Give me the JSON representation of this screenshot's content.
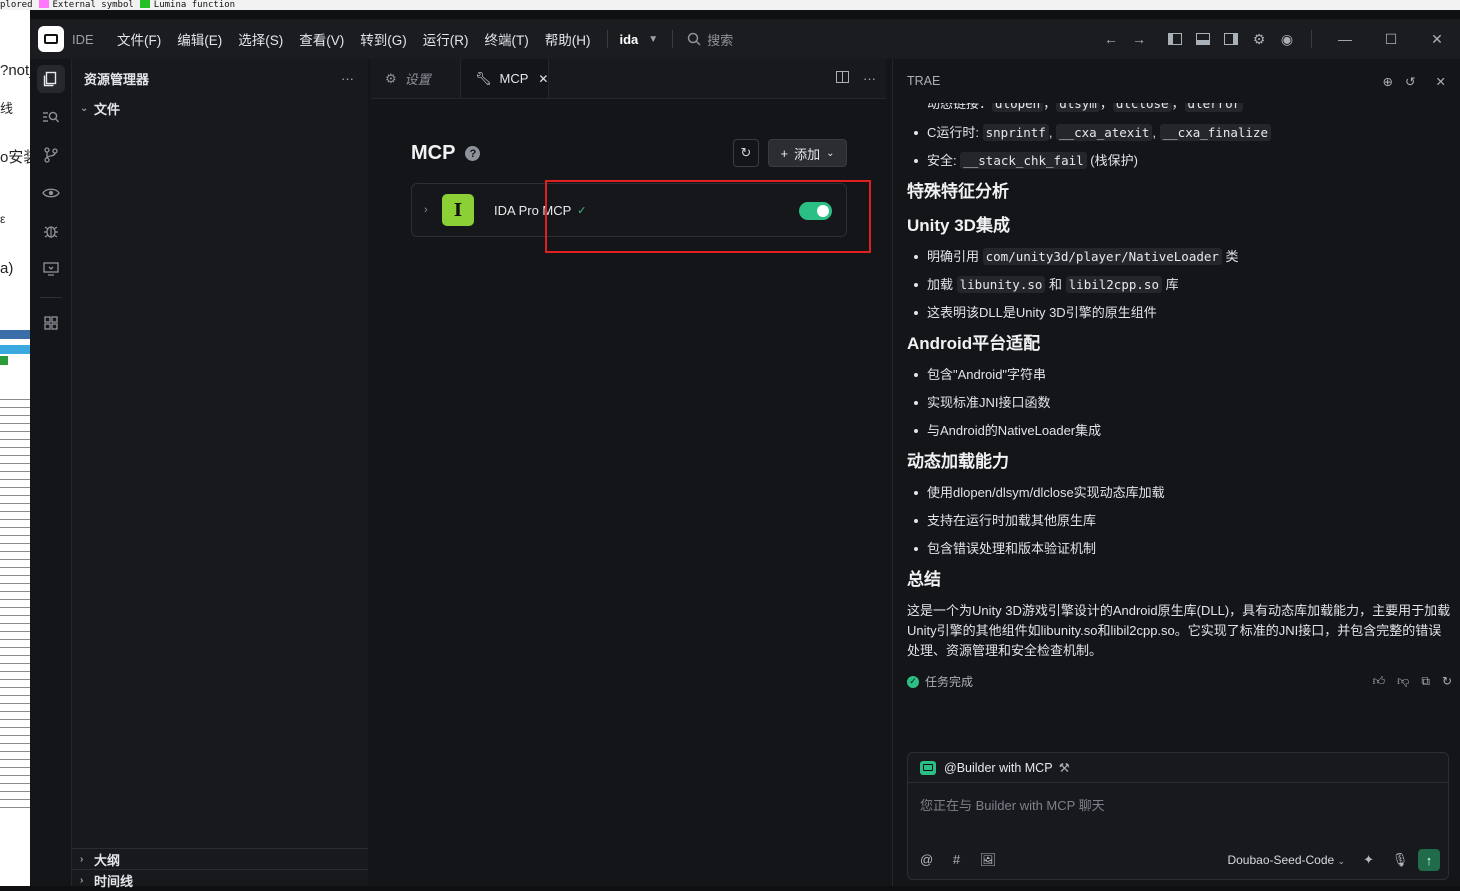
{
  "background": {
    "top_legend": [
      "plored",
      "External symbol",
      "Lumina function"
    ],
    "left_fragments": [
      "?not_",
      "线",
      "o安装",
      "ε",
      "a)"
    ]
  },
  "titlebar": {
    "ide_label": "IDE",
    "menu": [
      "文件(F)",
      "编辑(E)",
      "选择(S)",
      "查看(V)",
      "转到(G)",
      "运行(R)",
      "终端(T)",
      "帮助(H)"
    ],
    "project": "ida",
    "search_placeholder": "搜索"
  },
  "explorer": {
    "title": "资源管理器",
    "root": "文件",
    "outline": "大纲",
    "timeline": "时间线"
  },
  "editor": {
    "tabs": [
      {
        "label": "设置",
        "icon": "gear-icon"
      },
      {
        "label": "MCP",
        "icon": "tool-icon"
      }
    ],
    "mcp_title": "MCP",
    "add_label": "添加",
    "server": {
      "icon_letter": "I",
      "name": "IDA Pro MCP",
      "enabled": true
    }
  },
  "chat": {
    "title": "TRAE",
    "truncated_line": [
      "动态链接：",
      "dlopen",
      "，",
      "dlsym",
      "，",
      "dlclose",
      "，",
      "dlerror"
    ],
    "runtime": {
      "label": "C运行时: ",
      "codes": [
        "snprintf",
        "__cxa_atexit",
        "__cxa_finalize"
      ]
    },
    "security": {
      "label": "安全: ",
      "code": "__stack_chk_fail",
      "suffix": " (栈保护)"
    },
    "h_special": "特殊特征分析",
    "h_unity": "Unity 3D集成",
    "unity_items": [
      {
        "pre": "明确引用 ",
        "code": "com/unity3d/player/NativeLoader",
        "post": " 类"
      },
      {
        "pre": "加载 ",
        "code": "libunity.so",
        "mid": " 和 ",
        "code2": "libil2cpp.so",
        "post": " 库"
      },
      {
        "pre": "这表明该DLL是Unity 3D引擎的原生组件"
      }
    ],
    "h_android": "Android平台适配",
    "android_items": [
      "包含\"Android\"字符串",
      "实现标准JNI接口函数",
      "与Android的NativeLoader集成"
    ],
    "h_dynamic": "动态加载能力",
    "dynamic_items": [
      "使用dlopen/dlsym/dlclose实现动态库加载",
      "支持在运行时加载其他原生库",
      "包含错误处理和版本验证机制"
    ],
    "h_summary": "总结",
    "summary": "这是一个为Unity 3D游戏引擎设计的Android原生库(DLL)，具有动态库加载能力，主要用于加载Unity引擎的其他组件如libunity.so和libil2cpp.so。它实现了标准的JNI接口，并包含完整的错误处理、资源管理和安全检查机制。",
    "status": "任务完成",
    "composer": {
      "agent": "@Builder with MCP",
      "placeholder": "您正在与 Builder with MCP 聊天",
      "model": "Doubao-Seed-Code"
    }
  }
}
